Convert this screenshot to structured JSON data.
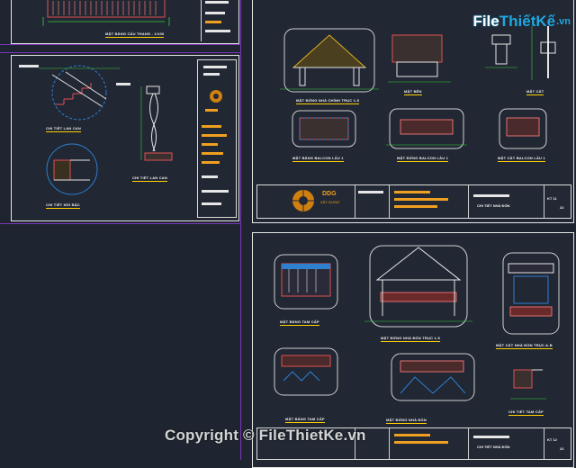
{
  "watermark": {
    "logo_file": "File",
    "logo_rest": "ThiếtKế",
    "logo_domain": ".vn",
    "copyright": "Copyright © FileThietKe.vn"
  },
  "sheet_top_left": {
    "caption": "MẶT BẰNG CẦU THANG - 1/100"
  },
  "sheet_mid_left": {
    "caption_1": "CHI TIẾT LAN CAN",
    "caption_2": "CHI TIẾT NỐI BẬC",
    "caption_3": "CHI TIẾT LAN CAN"
  },
  "sheet_top_right": {
    "captions": [
      "MẶT ĐỨNG NHÀ CHÍNH TRỤC 1-5",
      "MẶT BÊN",
      "MẶT CẮT",
      "MẶT BẰNG BALCON LẦU 1",
      "MẶT ĐỨNG BALCON LẦU 1",
      "MẶT CẮT BALCON LẦU 1"
    ],
    "title_block": {
      "company": "DDG",
      "sub": "XÂY DỰNG",
      "drawing": "CHI TIẾT NHÀ ĐÒN",
      "sheet": "KT 11",
      "total": "22"
    }
  },
  "sheet_bottom_right": {
    "captions": [
      "MẶT BẰNG TAM CẤP",
      "MẶT ĐỨNG NHÀ ĐÒN TRỤC 1-5",
      "MẶT CẮT NHÀ ĐÒN TRỤC A-B",
      "MẶT BẰNG TAM CẤP",
      "MẶT ĐỨNG NHÀ ĐÒN",
      "CHI TIẾT TAM CẤP"
    ],
    "title_block": {
      "drawing": "CHI TIẾT NHÀ ĐÒN",
      "sheet": "KT 12",
      "total": "22"
    }
  }
}
